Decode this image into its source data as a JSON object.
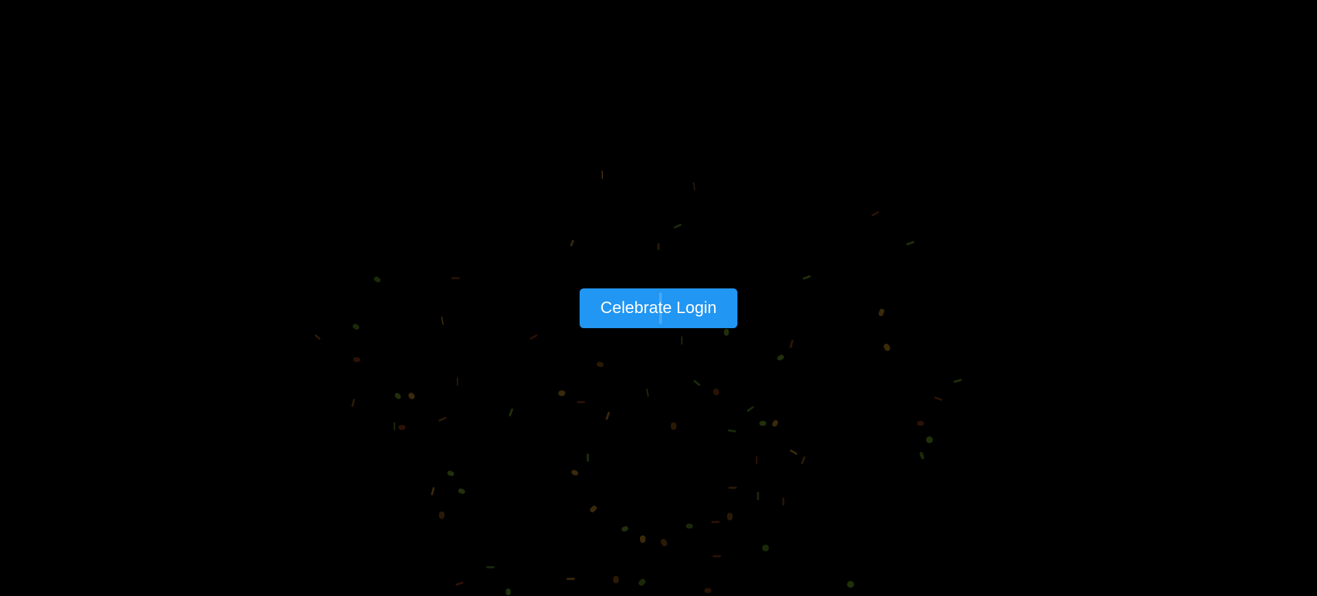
{
  "button": {
    "label": "Celebrate Login",
    "color": "#2196f3"
  },
  "background": "#000000",
  "confetti_colors": [
    "#3a2a0a",
    "#2a1a05",
    "#1a2a08",
    "#2b1205",
    "#20300a"
  ]
}
